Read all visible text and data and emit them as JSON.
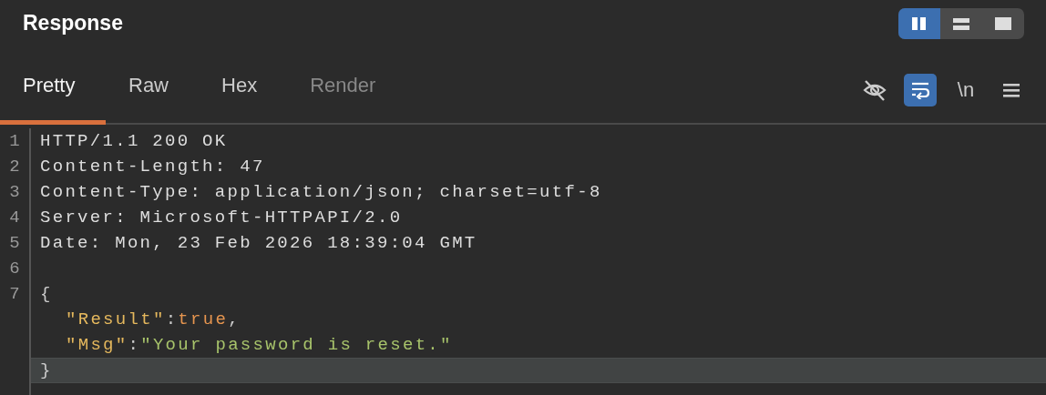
{
  "panel": {
    "title": "Response"
  },
  "layout_buttons": [
    {
      "kind": "columns",
      "selected": true
    },
    {
      "kind": "rows",
      "selected": false
    },
    {
      "kind": "single",
      "selected": false
    }
  ],
  "tabs": [
    {
      "label": "Pretty",
      "selected": true,
      "disabled": false
    },
    {
      "label": "Raw",
      "selected": false,
      "disabled": false
    },
    {
      "label": "Hex",
      "selected": false,
      "disabled": false
    },
    {
      "label": "Render",
      "selected": false,
      "disabled": true
    }
  ],
  "tools": [
    {
      "kind": "hide",
      "selected": false
    },
    {
      "kind": "wrap",
      "selected": true
    },
    {
      "kind": "newline",
      "label": "\\n",
      "selected": false
    },
    {
      "kind": "menu",
      "selected": false
    }
  ],
  "lines": [
    {
      "number": "1",
      "highlighted": false,
      "tokens": [
        {
          "kind": "plain",
          "text": "HTTP/1.1 200 OK"
        }
      ]
    },
    {
      "number": "2",
      "highlighted": false,
      "tokens": [
        {
          "kind": "plain",
          "text": "Content-Length: 47"
        }
      ]
    },
    {
      "number": "3",
      "highlighted": false,
      "tokens": [
        {
          "kind": "plain",
          "text": "Content-Type: application/json; charset=utf-8"
        }
      ]
    },
    {
      "number": "4",
      "highlighted": false,
      "tokens": [
        {
          "kind": "plain",
          "text": "Server: Microsoft-HTTPAPI/2.0"
        }
      ]
    },
    {
      "number": "5",
      "highlighted": false,
      "tokens": [
        {
          "kind": "plain",
          "text": "Date: Mon, 23 Feb 2026 18:39:04 GMT"
        }
      ]
    },
    {
      "number": "6",
      "highlighted": false
    },
    {
      "number": "7",
      "highlighted": false,
      "tokens": [
        {
          "kind": "punct",
          "text": "{"
        }
      ]
    },
    {
      "highlighted": false,
      "indent": true,
      "tokens": [
        {
          "kind": "key",
          "text": "\"Result\""
        },
        {
          "kind": "punct",
          "text": ":"
        },
        {
          "kind": "bool",
          "text": "true"
        },
        {
          "kind": "punct",
          "text": ","
        }
      ]
    },
    {
      "highlighted": false,
      "indent": true,
      "tokens": [
        {
          "kind": "key",
          "text": "\"Msg\""
        },
        {
          "kind": "punct",
          "text": ":"
        },
        {
          "kind": "string",
          "text": "\"Your password is reset.\""
        }
      ]
    },
    {
      "highlighted": true,
      "tokens": [
        {
          "kind": "punct",
          "text": "}"
        }
      ]
    }
  ]
}
